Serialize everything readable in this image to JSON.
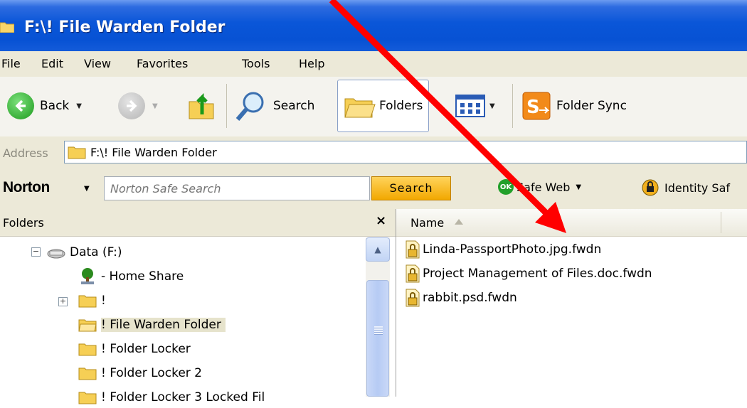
{
  "window": {
    "title": "F:\\! File Warden Folder"
  },
  "menu": [
    "File",
    "Edit",
    "View",
    "Favorites",
    "Tools",
    "Help"
  ],
  "toolbar": {
    "back_label": "Back",
    "search_label": "Search",
    "folders_label": "Folders",
    "foldersync_label": "Folder Sync"
  },
  "address": {
    "label": "Address",
    "value": "F:\\! File Warden Folder"
  },
  "norton": {
    "logo": "Norton",
    "search_placeholder": "Norton Safe Search",
    "search_button": "Search",
    "safeweb_badge": "OK",
    "safeweb_label": "Safe Web",
    "identity_label": "Identity Saf"
  },
  "folders_pane": {
    "title": "Folders",
    "close": "×",
    "tree": [
      {
        "label": "Data (F:)",
        "expander": "−"
      },
      {
        "label": "- Home Share"
      },
      {
        "label": "!",
        "expander": "+"
      },
      {
        "label": "! File Warden Folder",
        "selected": true
      },
      {
        "label": "! Folder Locker"
      },
      {
        "label": "! Folder Locker 2"
      },
      {
        "label": "! Folder Locker 3 Locked Fil"
      }
    ]
  },
  "file_list": {
    "columns": [
      "Name"
    ],
    "files": [
      "Linda-PassportPhoto.jpg.fwdn",
      "Project Management of Files.doc.fwdn",
      "rabbit.psd.fwdn"
    ]
  },
  "colors": {
    "titlebar": "#0a56d8",
    "chrome": "#ece9d8",
    "arrow": "#ff0000",
    "norton_button": "#f2a800"
  }
}
